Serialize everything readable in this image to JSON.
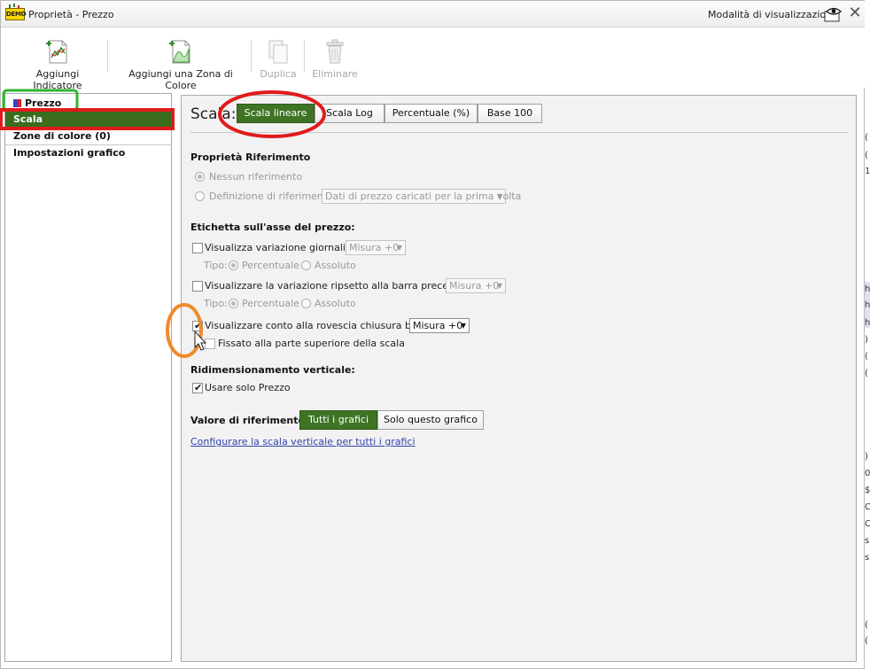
{
  "window": {
    "title": "Proprietà - Prezzo",
    "demo_badge": "DEMO",
    "view_mode_label": "Modalità di visualizzazione",
    "close_symbol": "✕"
  },
  "toolbar": {
    "add_indicator": "Aggiungi Indicatore",
    "add_color_zone": "Aggiungi una Zona di Colore",
    "duplicate": "Duplica",
    "delete": "Eliminare"
  },
  "sidebar": {
    "items": [
      {
        "label": "Prezzo"
      },
      {
        "label": "Scala"
      },
      {
        "label": "Zone di colore (0)"
      },
      {
        "label": "Impostazioni grafico"
      }
    ]
  },
  "scale": {
    "label": "Scala:",
    "options": [
      "Scala lineare",
      "Scala Log",
      "Percentuale (%)",
      "Base 100"
    ],
    "selected": "Scala lineare"
  },
  "reference_props": {
    "heading": "Proprietà Riferimento",
    "no_reference": "Nessun riferimento",
    "define_reference": "Definizione di riferimento:",
    "reference_value": "Dati di prezzo caricati per la prima volta"
  },
  "price_axis_label": {
    "heading": "Etichetta sull'asse del prezzo:",
    "daily_change": "Visualizza variazione giornaliera",
    "daily_change_measure": "Misura +0",
    "type_label": "Tipo:",
    "percentage": "Percentuale",
    "absolute": "Assoluto",
    "prev_bar_change": "Visualizzare la variazione ripsetto alla barra precedente",
    "prev_bar_measure": "Misura +0",
    "countdown": "Visualizzare conto alla rovescia chiusura barra",
    "countdown_measure": "Misura +0",
    "fixed_top": "Fissato alla parte superiore della scala"
  },
  "vertical_resize": {
    "heading": "Ridimensionamento verticale:",
    "use_price_only": "Usare solo Prezzo"
  },
  "reference_value": {
    "label": "Valore di riferimento:",
    "all_charts": "Tutti i grafici",
    "this_chart": "Solo questo grafico",
    "configure_link": "Configurare la scala verticale per tutti i grafici"
  },
  "background_strip": {
    "chars": [
      "(",
      "(",
      "1",
      "h",
      "h",
      "h",
      ")",
      "(",
      "(",
      ")",
      "0",
      "$",
      "C",
      "C",
      "s",
      "s",
      "(",
      "("
    ]
  },
  "colors": {
    "accent_green": "#3f7424",
    "sidebar_selected": "#3a6d1e",
    "annotation_red": "#e01b1b",
    "annotation_green": "#2db52d",
    "annotation_orange": "#f08a2c",
    "link_blue": "#3344aa"
  }
}
